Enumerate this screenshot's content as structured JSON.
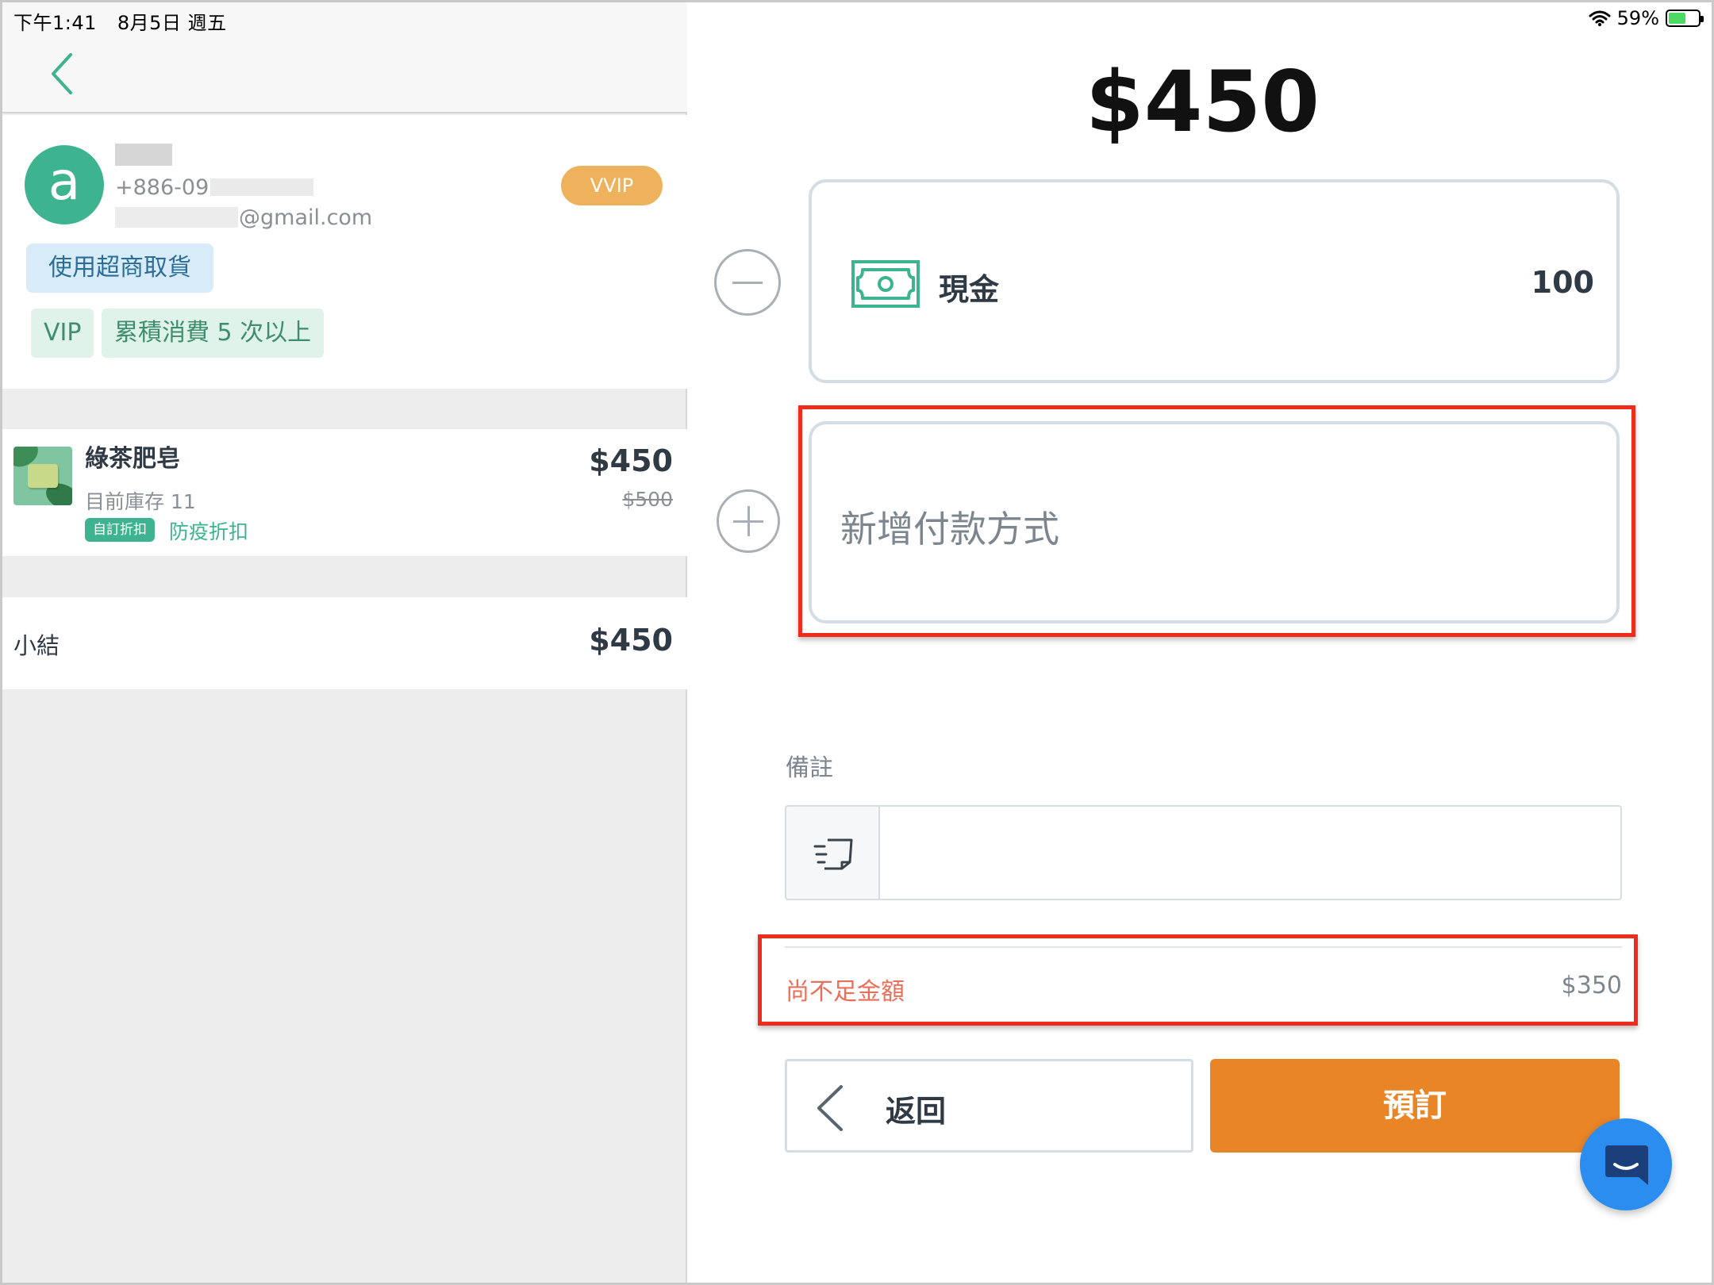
{
  "status_bar": {
    "time": "下午1:41",
    "date": "8月5日 週五",
    "battery": "59%",
    "battery_level": 0.59
  },
  "customer": {
    "avatar_letter": "a",
    "phone_prefix": "+886-09",
    "email_suffix": "@gmail.com",
    "level_badge": "VVIP",
    "pickup_tag": "使用超商取貨",
    "tags": [
      "VIP",
      "累積消費 5 次以上"
    ]
  },
  "product": {
    "name": "綠茶肥皂",
    "stock": "目前庫存 11",
    "discount_badge": "自訂折扣",
    "discount_name": "防疫折扣",
    "price": "$450",
    "original_price": "$500"
  },
  "subtotal": {
    "label": "小結",
    "value": "$450"
  },
  "payment": {
    "total": "$450",
    "method_label": "現金",
    "method_amount": "100",
    "add_method_label": "新增付款方式"
  },
  "note": {
    "label": "備註",
    "value": ""
  },
  "shortfall": {
    "label": "尚不足金額",
    "value": "$350"
  },
  "buttons": {
    "back_label": "返回",
    "reserve_label": "預訂"
  },
  "colors": {
    "accent_green": "#3db48f",
    "primary_orange": "#e88527",
    "highlight_red": "#ee2c1c",
    "vvip_orange": "#efb25c",
    "chat_blue": "#2b8df0"
  },
  "icons": {
    "back": "chevron-left-icon",
    "cash": "cash-icon",
    "note": "note-icon",
    "remove": "minus-circle-icon",
    "add": "plus-circle-icon",
    "chat": "chat-icon",
    "wifi": "wifi-icon",
    "battery": "battery-icon"
  }
}
